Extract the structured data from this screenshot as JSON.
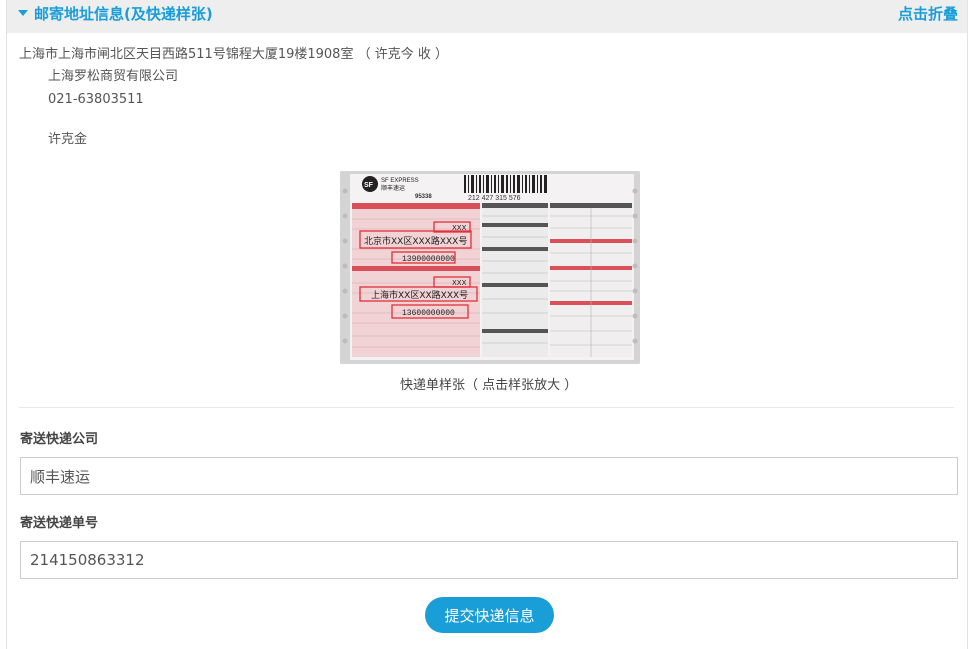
{
  "header": {
    "title": "邮寄地址信息(及快递样张)",
    "collapse_label": "点击折叠"
  },
  "address": {
    "line": "上海市上海市闸北区天目西路511号锦程大厦19楼1908室 （ 许克今 收 ）",
    "company": "上海罗松商贸有限公司",
    "phone": "021-63803511",
    "contact": "许克金"
  },
  "sample": {
    "caption": "快递单样张（ 点击样张放大 ）",
    "waybill": {
      "brand": "SF EXPRESS",
      "brand_cn": "顺丰速运",
      "tracking": "212 427 315 576",
      "hotline": "95338",
      "sender_name": "XXX",
      "sender_address": "北京市XX区XXX路XXX号",
      "sender_phone": "13900000000",
      "recipient_name": "XXX",
      "recipient_address": "上海市XX区XX路XXX号",
      "recipient_phone": "13600000000"
    }
  },
  "form": {
    "company_label": "寄送快递公司",
    "company_value": "顺丰速运",
    "number_label": "寄送快递单号",
    "number_value": "214150863312",
    "submit_label": "提交快递信息"
  },
  "colors": {
    "accent": "#1a9ed8",
    "header_bg": "#eeeeee",
    "highlight_red": "#e0303a"
  }
}
